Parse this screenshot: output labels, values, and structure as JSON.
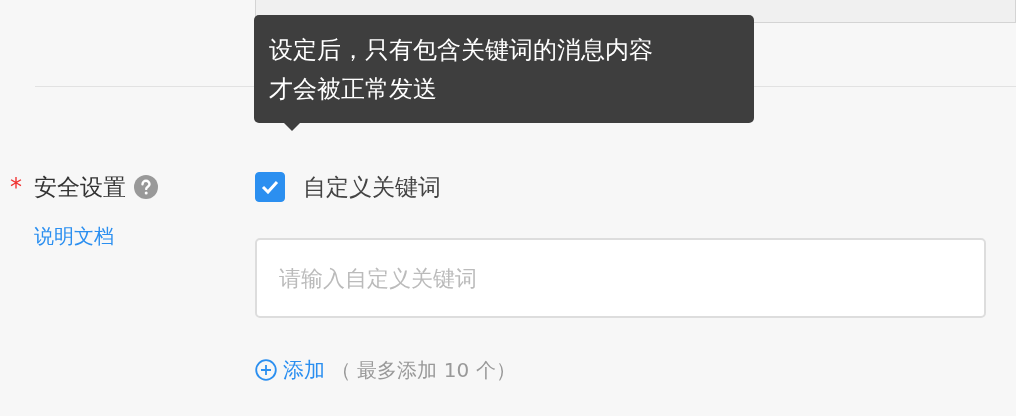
{
  "tooltip": {
    "lines": [
      "设定后，只有包含关键词的消息内容",
      "才会被正常发送"
    ]
  },
  "security": {
    "label": "安全设置",
    "required_mark": "*",
    "help_link": "说明文档",
    "checkbox": {
      "label": "自定义关键词",
      "checked": true
    },
    "keyword_input": {
      "placeholder": "请输入自定义关键词"
    },
    "add_button": "添加",
    "add_note": "（ 最多添加 10 个）"
  }
}
